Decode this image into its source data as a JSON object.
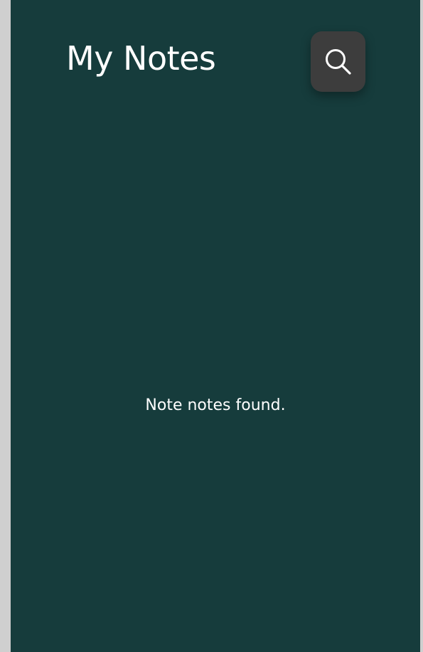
{
  "header": {
    "title": "My Notes"
  },
  "search_button": {
    "icon": "search-icon"
  },
  "notes": {
    "empty_message": "Note notes found."
  },
  "colors": {
    "background": "#163c3c",
    "button": "#3d3d3d",
    "text": "#ffffff",
    "outside": "#cfcfcf"
  }
}
